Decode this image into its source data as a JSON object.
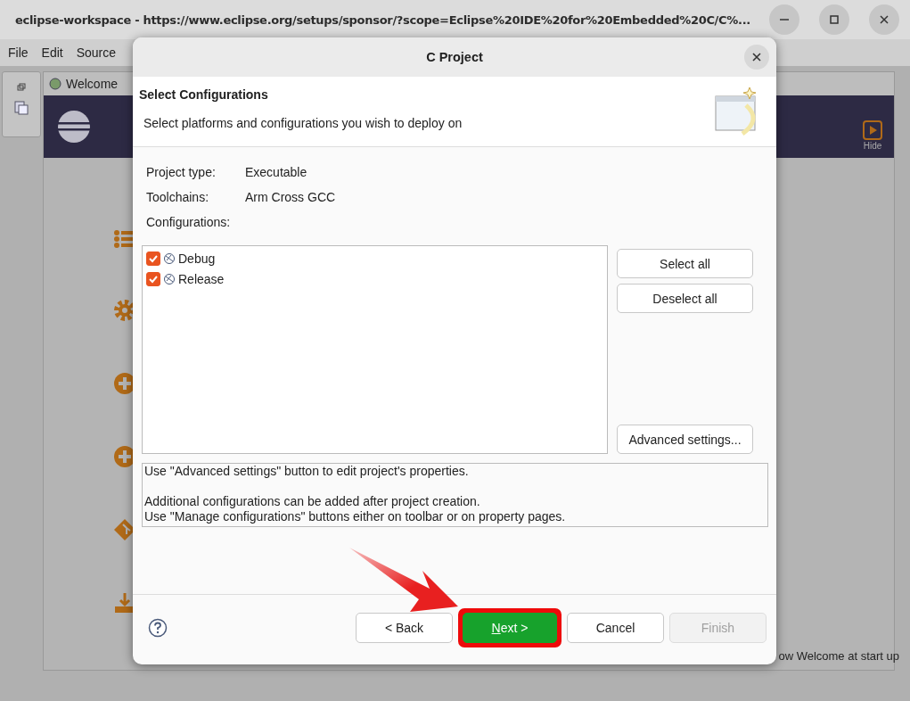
{
  "window": {
    "title": "eclipse-workspace - https://www.eclipse.org/setups/sponsor/?scope=Eclipse%20IDE%20for%20Embedded%20C/C%..."
  },
  "menu": [
    "File",
    "Edit",
    "Source"
  ],
  "tabs": [
    {
      "label": "Welcome"
    }
  ],
  "welcome": {
    "hide_label": "Hide",
    "startup_text": "ow Welcome at start up"
  },
  "dialog": {
    "title": "C Project",
    "heading": "Select Configurations",
    "subtitle": "Select platforms and configurations you wish to deploy on",
    "fields": [
      {
        "label": "Project type:",
        "value": "Executable"
      },
      {
        "label": "Toolchains:",
        "value": "Arm Cross GCC"
      }
    ],
    "configurations_label": "Configurations:",
    "configurations": [
      {
        "name": "Debug",
        "checked": true
      },
      {
        "name": "Release",
        "checked": true
      }
    ],
    "side_buttons": [
      "Select all",
      "Deselect all",
      "Advanced settings..."
    ],
    "info": [
      {
        "lines": [
          "Use \"Advanced settings\" button to edit project's properties."
        ]
      },
      {
        "lines": [
          "Additional configurations can be added after project creation.",
          "Use \"Manage configurations\" buttons either on toolbar or on property pages."
        ]
      }
    ],
    "buttons": [
      {
        "label": "< Back",
        "disabled": false,
        "highlighted": false
      },
      {
        "label": "Next >",
        "disabled": false,
        "highlighted": true
      },
      {
        "label": "Cancel",
        "disabled": false,
        "highlighted": false
      },
      {
        "label": "Finish",
        "disabled": true,
        "highlighted": false
      }
    ]
  }
}
